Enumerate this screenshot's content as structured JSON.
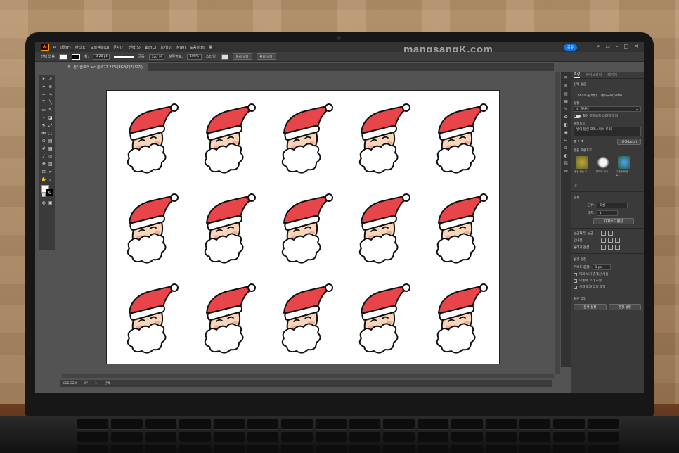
{
  "watermark": "mangsangK.com",
  "app": {
    "logo": "Ai",
    "menu": [
      "파일(F)",
      "편집(E)",
      "오브젝트(O)",
      "문자(T)",
      "선택(S)",
      "효과(C)",
      "보기(V)",
      "창(W)",
      "도움말(H)"
    ],
    "share_label": "공유"
  },
  "control_bar": {
    "selection_label": "선택 없음",
    "stroke_label": "획:",
    "stroke_value": "0.28 pt",
    "stroke_style": "균등",
    "brush_size": "3pt. 원",
    "opacity_label": "불투명도:",
    "opacity_value": "100%",
    "style_label": "스타일:",
    "doc_setup": "문서 설정",
    "prefs": "환경 설정"
  },
  "document_tab": {
    "title": "산타클로스.aic @ 822.22%(RGB/미리 보기)"
  },
  "status_bar": {
    "zoom": "822.22%",
    "rotation": "0°",
    "artboard": "1",
    "tool": "선택"
  },
  "artwork": {
    "rows": 3,
    "cols": 5,
    "hat_color": "#e8454a",
    "face_color": "#f6d5b8",
    "cheek_color": "#f7a9a0",
    "beard_color": "#ffffff",
    "outline_color": "#111111"
  },
  "panel": {
    "tabs": [
      "속성",
      "라이브러리",
      "레이어"
    ],
    "selection": "선택 없음",
    "gen_section": "텍스트를 벡터 그래픽으로(beta)",
    "type_label": "유형",
    "type_value": "피사체",
    "match_style": "활성 아트보드 스타일 일치",
    "prompt_label": "프롬프트",
    "prompt_placeholder": "벌이 달린 크리스마스 트리",
    "generate": "생성(beta)",
    "sample_prompts": "샘플 프롬프트",
    "samples": [
      "용을 품는 드...",
      "장미와 가시...",
      "다채한 픽셀 로..."
    ],
    "document_section": "문서",
    "units_label": "단위:",
    "units_value": "픽셀",
    "artboard_label": "대지:",
    "artboard_value": "1",
    "edit_artboards": "대지보드 편집",
    "rulers_grid": "눈금자 및 눈금",
    "guides": "안내선",
    "snap_options": "물리기 옵션",
    "prefs_section": "환경 설정",
    "keyboard_increment_label": "키보드 증감:",
    "keyboard_increment_value": "1 px",
    "cb_preview_bounds": "미리 보기 경계선 사용",
    "cb_scale_corners": "모퉁이 크기 조절",
    "cb_scale_strokes": "선과 효과 크기 조절",
    "quick_actions": "빠른 작업",
    "qa_doc_setup": "문서 설정",
    "qa_prefs": "환경 설정"
  }
}
